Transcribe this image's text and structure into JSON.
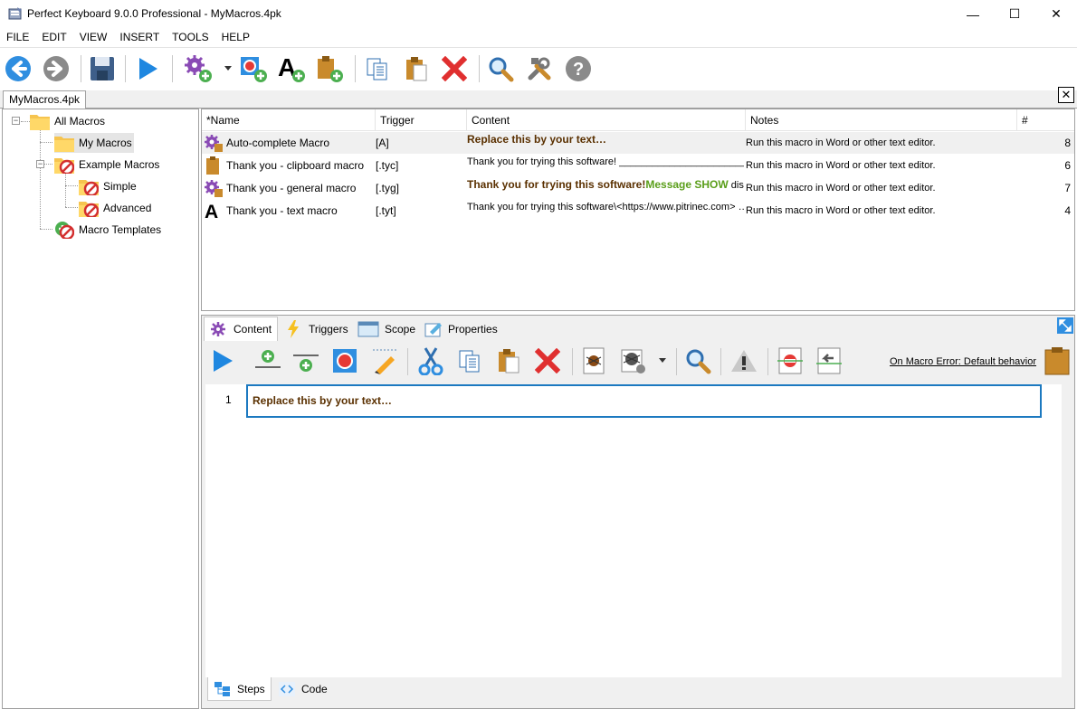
{
  "window": {
    "title": "Perfect Keyboard 9.0.0 Professional - MyMacros.4pk",
    "minimize": "—",
    "maximize": "☐",
    "close": "✕"
  },
  "menu": [
    "FILE",
    "EDIT",
    "VIEW",
    "INSERT",
    "TOOLS",
    "HELP"
  ],
  "toolbar": {
    "icons": [
      "back-icon",
      "forward-icon",
      "save-icon",
      "play-icon",
      "new-macro-icon",
      "dropdown-arrow-icon",
      "new-record-icon",
      "new-text-macro-icon",
      "new-clipboard-macro-icon",
      "copy-icon",
      "paste-icon",
      "delete-icon",
      "search-icon",
      "tools-icon",
      "help-icon"
    ]
  },
  "doc_tab": {
    "label": "MyMacros.4pk",
    "close": "✕"
  },
  "tree": {
    "nodes": [
      {
        "label": "All Macros",
        "icon": "folder-icon"
      },
      {
        "label": "My Macros",
        "icon": "folder-icon"
      },
      {
        "label": "Example Macros",
        "icon": "folder-restricted-icon"
      },
      {
        "label": "Simple",
        "icon": "folder-restricted-icon"
      },
      {
        "label": "Advanced",
        "icon": "folder-restricted-icon"
      },
      {
        "label": "Macro Templates",
        "icon": "template-restricted-icon"
      }
    ]
  },
  "list": {
    "columns": [
      "*Name",
      "Trigger",
      "Content",
      "Notes",
      "#"
    ],
    "rows": [
      {
        "name": "Auto-complete Macro",
        "trigger": "[A]",
        "content": "Replace this by your text…",
        "notes": "Run this macro in Word or other text editor.",
        "count": "8",
        "icon": "gear-macro-icon"
      },
      {
        "name": "Thank you - clipboard macro",
        "trigger": "[.tyc]",
        "content": "Thank you for trying this software! ________________________…",
        "notes": "Run this macro in Word or other text editor.",
        "count": "6",
        "icon": "clipboard-macro-icon"
      },
      {
        "name": "Thank you - general macro",
        "trigger": "[.tyg]",
        "content_bold": "Thank you for trying this software!",
        "content_green": "Message SHOW",
        "content_tail": " disp",
        "notes": "Run this macro in Word or other text editor.",
        "count": "7",
        "icon": "gear-macro-icon"
      },
      {
        "name": "Thank you - text macro",
        "trigger": "[.tyt]",
        "content": "Thank you for trying this software\\<https://www.pitrinec.com> …",
        "notes": "Run this macro in Word or other text editor.",
        "count": "4",
        "icon": "text-macro-icon"
      }
    ]
  },
  "editor_tabs": [
    "Content",
    "Triggers",
    "Scope",
    "Properties"
  ],
  "editor_toolbar": {
    "icons": [
      "run-icon",
      "insert-step-above-icon",
      "insert-step-below-icon",
      "record-icon",
      "edit-icon",
      "cut-icon",
      "copy-icon",
      "paste-icon",
      "delete-icon",
      "debug-icon",
      "debug-options-icon",
      "dropdown-arrow-icon",
      "search-icon",
      "warning-icon",
      "disable-step-icon",
      "enable-step-icon"
    ],
    "macro_error": "On Macro Error: Default behavior"
  },
  "editor": {
    "line_number": "1",
    "step_text": "Replace this by your text…"
  },
  "footer_tabs": [
    "Steps",
    "Code"
  ]
}
